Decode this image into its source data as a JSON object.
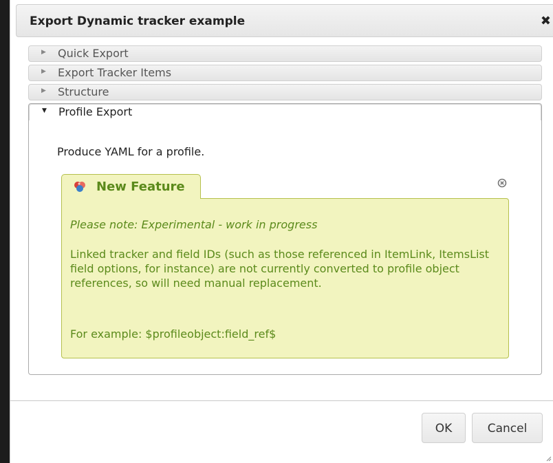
{
  "dialog": {
    "title": "Export Dynamic tracker example",
    "close_icon": "close-icon"
  },
  "accordion": {
    "sections": [
      {
        "label": "Quick Export",
        "expanded": false
      },
      {
        "label": "Export Tracker Items",
        "expanded": false
      },
      {
        "label": "Structure",
        "expanded": false
      },
      {
        "label": "Profile Export",
        "expanded": true
      }
    ]
  },
  "profile_export": {
    "intro": "Produce YAML for a profile.",
    "feature": {
      "icon": "new-feature-icon",
      "title": "New Feature",
      "note": "Please note: Experimental - work in progress",
      "body": "Linked tracker and field IDs (such as those referenced in ItemLink, ItemsList field options, for instance) are not currently converted to profile object references, so will need manual replacement.",
      "example": "For example: $profileobject:field_ref$"
    }
  },
  "buttons": {
    "ok_label": "OK",
    "cancel_label": "Cancel"
  },
  "colors": {
    "feature_background": "#f2f4bf",
    "feature_border": "#b5c04c",
    "feature_text": "#5b8a1b"
  }
}
